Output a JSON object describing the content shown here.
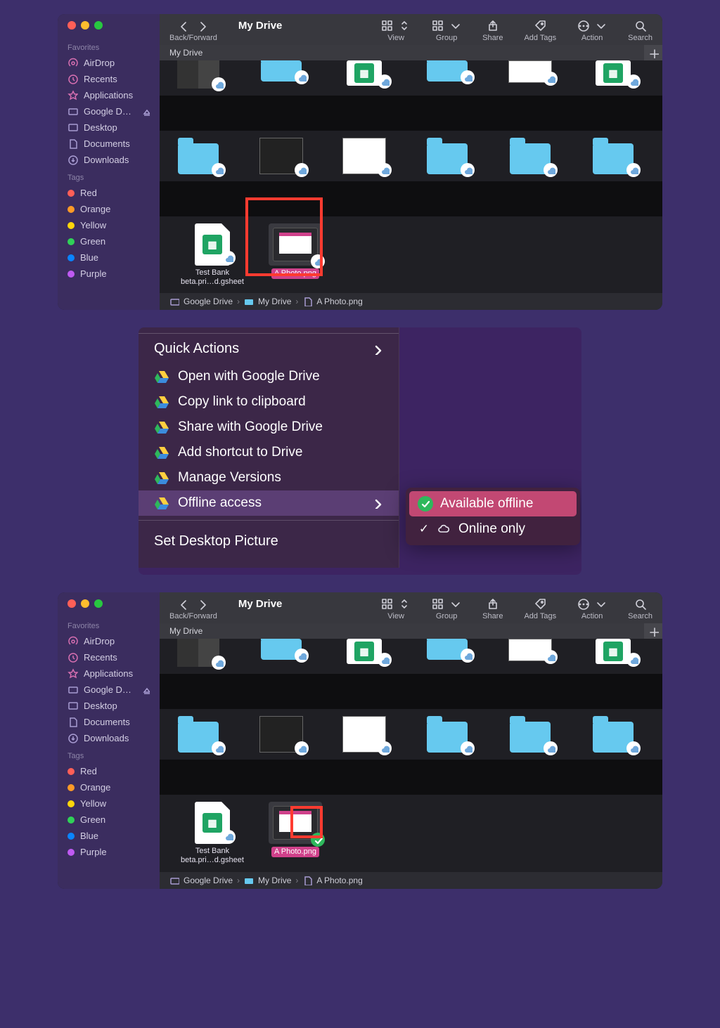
{
  "window": {
    "title": "My Drive",
    "back_forward_label": "Back/Forward",
    "tab_title": "My Drive",
    "toolbar": {
      "view": "View",
      "group": "Group",
      "share": "Share",
      "add_tags": "Add Tags",
      "action": "Action",
      "search": "Search"
    }
  },
  "sidebar": {
    "favorites_head": "Favorites",
    "favorites": [
      {
        "label": "AirDrop"
      },
      {
        "label": "Recents"
      },
      {
        "label": "Applications"
      },
      {
        "label": "Google D…"
      },
      {
        "label": "Desktop"
      },
      {
        "label": "Documents"
      },
      {
        "label": "Downloads"
      }
    ],
    "tags_head": "Tags",
    "tags": [
      {
        "label": "Red",
        "color": "#ff5f57"
      },
      {
        "label": "Orange",
        "color": "#fd9a27"
      },
      {
        "label": "Yellow",
        "color": "#ffd60a"
      },
      {
        "label": "Green",
        "color": "#30d158"
      },
      {
        "label": "Blue",
        "color": "#0a84ff"
      },
      {
        "label": "Purple",
        "color": "#bf5af2"
      }
    ]
  },
  "files": {
    "test_bank_line1": "Test Bank",
    "test_bank_line2": "beta.pri…d.gsheet",
    "photo": "A Photo.png"
  },
  "pathbar": {
    "root": "Google Drive",
    "folder": "My Drive",
    "file": "A Photo.png"
  },
  "context_menu": {
    "header": "Quick Actions",
    "items": [
      "Open with Google Drive",
      "Copy link to clipboard",
      "Share with Google Drive",
      "Add shortcut to Drive",
      "Manage Versions",
      "Offline access"
    ],
    "set_desktop": "Set Desktop Picture",
    "submenu": {
      "available_offline": "Available offline",
      "online_only": "Online only"
    }
  }
}
